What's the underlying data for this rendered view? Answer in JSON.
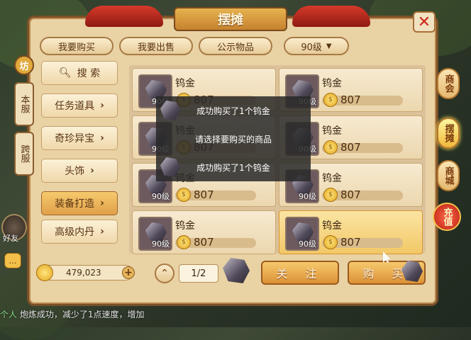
{
  "title": "摆摊",
  "top_tabs": [
    "我要购买",
    "我要出售",
    "公示物品"
  ],
  "level_filter": "90级",
  "side_tabs": [
    "本服",
    "跨服"
  ],
  "side_tag": "坊",
  "categories": [
    {
      "label": "搜 索",
      "icon": "search-icon"
    },
    {
      "label": "任务道具",
      "icon": "chevron-right-icon"
    },
    {
      "label": "奇珍异宝",
      "icon": "chevron-right-icon"
    },
    {
      "label": "头饰",
      "icon": "chevron-right-icon"
    },
    {
      "label": "装备打造",
      "icon": "chevron-right-icon"
    },
    {
      "label": "高级内丹",
      "icon": "chevron-right-icon"
    }
  ],
  "items": [
    {
      "name": "钨金",
      "level": "90级",
      "price": "807"
    },
    {
      "name": "钨金",
      "level": "90级",
      "price": "807"
    },
    {
      "name": "钨金",
      "level": "90级",
      "price": "807"
    },
    {
      "name": "钨金",
      "level": "90级",
      "price": "807"
    },
    {
      "name": "钨金",
      "level": "90级",
      "price": "807"
    },
    {
      "name": "钨金",
      "level": "90级",
      "price": "807"
    },
    {
      "name": "钨金",
      "level": "90级",
      "price": "807"
    },
    {
      "name": "钨金",
      "level": "90级",
      "price": "807"
    }
  ],
  "toasts": [
    "成功购买了1个钨金",
    "请选择要购买的商品",
    "成功购买了1个钨金"
  ],
  "money": "479,023",
  "page": "1/2",
  "follow_label": "关 注",
  "buy_label": "购 买",
  "right_nav": [
    "商会",
    "摆摊",
    "商城"
  ],
  "charge_label": "充值",
  "friend_label": "好友",
  "chat": {
    "prefix": "个人",
    "text": "炮炼成功，减少了1点速度，增加"
  },
  "colors": {
    "accent": "#e0a04a",
    "panel": "#e9d2a4",
    "close": "#d0261b"
  }
}
